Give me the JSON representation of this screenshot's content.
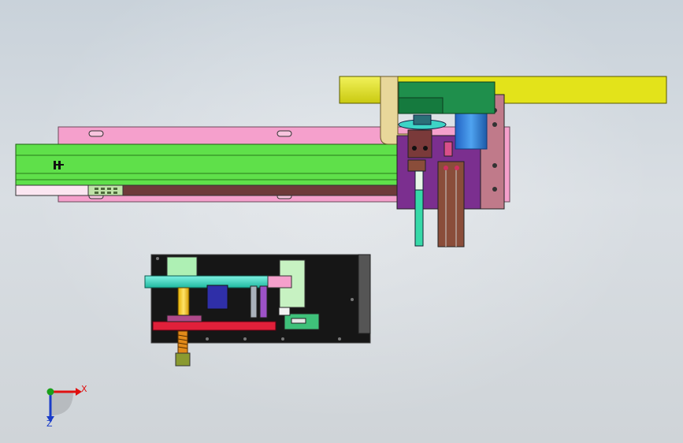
{
  "viewport": {
    "background_top": "#c9d2da",
    "background_bottom": "#cfd4d8"
  },
  "colors": {
    "rail_green": "#5fe04a",
    "plate_pink": "#f5a0cc",
    "bracket_yellow": "#e3e31a",
    "block_purple": "#7b2f8f",
    "cylinder_blue": "#2f7fd9",
    "motor_green": "#1f8f4c",
    "rod_brown": "#8a4d3a",
    "base_black": "#161616",
    "gear_teal": "#36d9c0",
    "plate_red": "#e0203a",
    "axis_x": "#e01010",
    "axis_y": "#1aa01a",
    "axis_z": "#1a3cc8"
  },
  "triad": {
    "x_label": "X",
    "z_label": "Z"
  }
}
